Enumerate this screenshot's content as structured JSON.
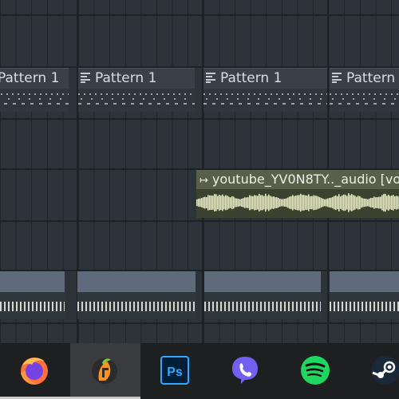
{
  "playlist": {
    "patterns": [
      {
        "label": "Pattern 1"
      },
      {
        "label": "Pattern 1"
      },
      {
        "label": "Pattern 1"
      },
      {
        "label": "Pattern"
      }
    ],
    "audio_clip": {
      "label": "youtube_YV0N8TY.._audio [vo"
    }
  },
  "taskbar": {
    "apps": [
      {
        "name": "Firefox",
        "icon": "firefox-icon",
        "active": false,
        "open": true
      },
      {
        "name": "FL Studio",
        "icon": "fl-studio-icon",
        "active": true,
        "open": true
      },
      {
        "name": "Photoshop",
        "icon": "photoshop-icon",
        "active": false,
        "open": false,
        "glyph": "Ps"
      },
      {
        "name": "Viber",
        "icon": "viber-icon",
        "active": false,
        "open": false
      },
      {
        "name": "Spotify",
        "icon": "spotify-icon",
        "active": false,
        "open": false
      },
      {
        "name": "Steam",
        "icon": "steam-icon",
        "active": false,
        "open": false
      }
    ]
  },
  "colors": {
    "background": "#2c3339",
    "pattern_header": "#3a4047",
    "audio_header": "#58604a",
    "audio_wave": "#e9ecc9",
    "block_top": "#5f6b7b",
    "taskbar": "#1e1f21"
  }
}
